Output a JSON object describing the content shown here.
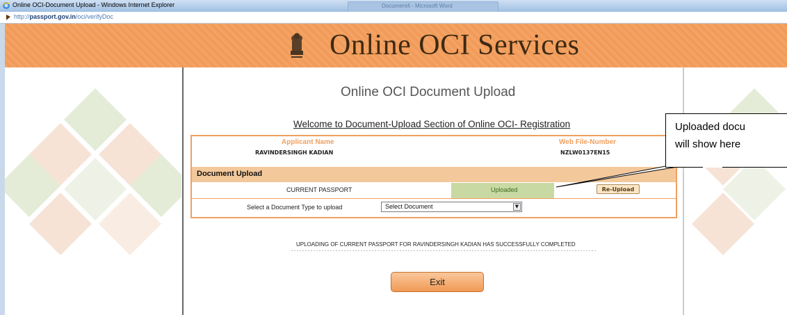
{
  "window": {
    "title": "Online OCI-Document Upload - Windows Internet Explorer",
    "background_app_title": "Document4 - Microsoft Word"
  },
  "address_bar": {
    "url_prefix": "http://",
    "url_domain": "passport.gov.in",
    "url_path": "/oci/verifyDoc"
  },
  "header": {
    "site_title": "Online OCI Services"
  },
  "page": {
    "heading": "Online OCI Document Upload",
    "welcome": "Welcome to Document-Upload Section of Online OCI- Registration",
    "applicant_label": "Applicant Name",
    "applicant_value": "RAVINDERSINGH KADIAN",
    "web_file_label": "Web File-Number",
    "web_file_value": "NZLW0137EN15",
    "section_title": "Document Upload",
    "documents": [
      {
        "name": "CURRENT PASSPORT",
        "status": "Uploaded",
        "action": "Re-Upload"
      }
    ],
    "select_label": "Select a Document Type to upload",
    "select_value": "Select Document",
    "message": "UPLOADING OF CURRENT PASSPORT FOR RAVINDERSINGH KADIAN HAS SUCCESSFULLY COMPLETED",
    "exit_label": "Exit"
  },
  "callout": {
    "line1": "Uploaded docu",
    "line2": "will show here"
  },
  "colors": {
    "header_orange": "#f29b58",
    "label_orange": "#f0a060",
    "section_bar": "#f3c89b",
    "uploaded_green": "#c9d9a3"
  }
}
